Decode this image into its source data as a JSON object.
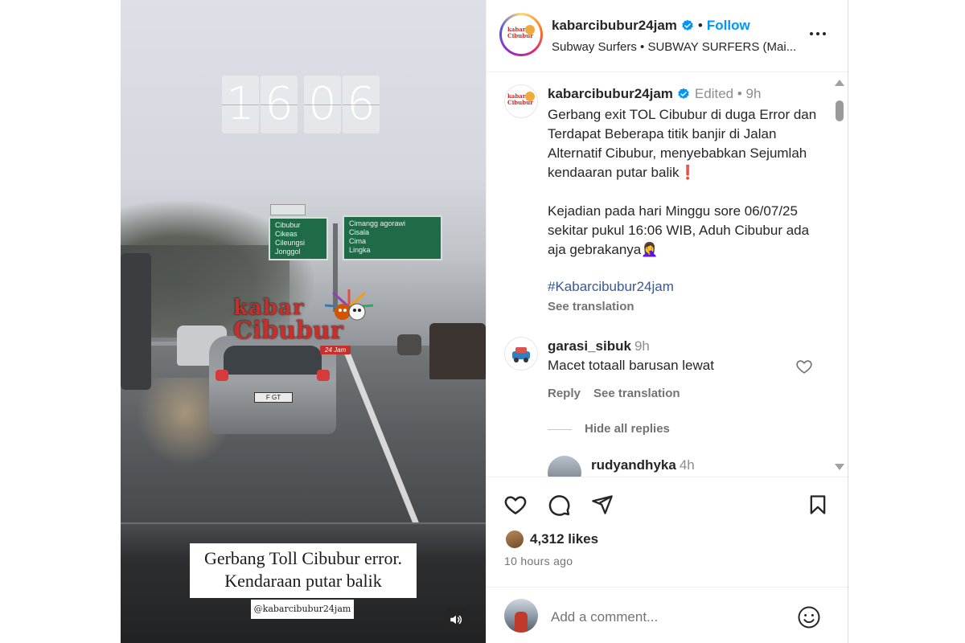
{
  "video": {
    "clock_digits": [
      "1",
      "6",
      "0",
      "6"
    ],
    "sign_left_lines": [
      "Cibubur",
      "Cikeas",
      "Cileungsi",
      "Jonggol"
    ],
    "sign_right_lines": [
      "Cimangg  agorawi",
      "Cisala",
      "Cima",
      "Lingka"
    ],
    "plate_text": "F    GT",
    "watermark": {
      "line1": "kabar",
      "line2": "Cibubur",
      "badge": "24 Jam"
    },
    "caption_line1": "Gerbang Toll Cibubur error.",
    "caption_line2": "Kendaraan putar balik",
    "handle_overlay": "@kabarcibubur24jam",
    "mute_icon": "speaker-icon"
  },
  "header": {
    "username": "kabarcibubur24jam",
    "dot": "•",
    "follow_label": "Follow",
    "audio": "Subway Surfers • SUBWAY SURFERS (Mai...",
    "more_icon": "more-horizontal-icon"
  },
  "caption": {
    "username": "kabarcibubur24jam",
    "meta": "Edited • 9h",
    "text": "Gerbang exit TOL Cibubur di duga Error dan Terdapat Beberapa titik banjir di Jalan Alternatif Cibubur, menyebabkan Sejumlah kendaaran putar balik❗\n\nKejadian pada hari Minggu sore 06/07/25 sekitar pukul 16:06 WIB, Aduh Cibubur ada aja gebrakanya🤦‍♀️",
    "hashtag": "#Kabarcibubur24jam",
    "see_translation": "See translation"
  },
  "comment": {
    "username": "garasi_sibuk",
    "time": "9h",
    "text": "Macet totaall barusan lewat",
    "reply_label": "Reply",
    "see_translation": "See translation",
    "hide_replies": "Hide all replies"
  },
  "reply": {
    "username": "rudyandhyka",
    "time": "4h"
  },
  "actions": {
    "likes": "4,312 likes",
    "time_ago": "10 hours ago"
  },
  "add_comment": {
    "placeholder": "Add a comment..."
  },
  "colors": {
    "accent_blue": "#0095f6",
    "hashtag": "#385898",
    "muted": "#737373",
    "watermark_red": "#c4302b"
  }
}
